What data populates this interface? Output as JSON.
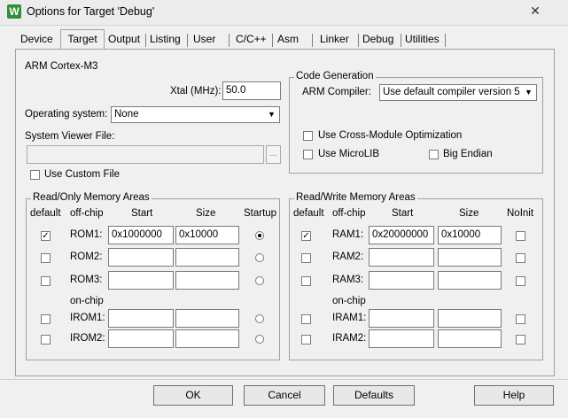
{
  "window": {
    "title": "Options for Target 'Debug'",
    "app_icon": "W",
    "close_glyph": "✕"
  },
  "tabs": [
    "Device",
    "Target",
    "Output",
    "Listing",
    "User",
    "C/C++",
    "Asm",
    "Linker",
    "Debug",
    "Utilities"
  ],
  "active_tab": "Target",
  "target": {
    "device_name": "ARM Cortex-M3",
    "xtal_label": "Xtal (MHz):",
    "xtal_value": "50.0",
    "os_label": "Operating system:",
    "os_value": "None",
    "sysviewer_label": "System Viewer File:",
    "sysviewer_value": "",
    "browse_label": "...",
    "custom_file_label": "Use Custom File"
  },
  "codegen": {
    "title": "Code Generation",
    "compiler_label": "ARM Compiler:",
    "compiler_value": "Use default compiler version 5",
    "cross_module_label": "Use Cross-Module Optimization",
    "microlib_label": "Use MicroLIB",
    "big_endian_label": "Big Endian"
  },
  "ro_memory": {
    "title": "Read/Only Memory Areas",
    "col_default": "default",
    "col_offchip": "off-chip",
    "col_start": "Start",
    "col_size": "Size",
    "col_startup": "Startup",
    "onchip_label": "on-chip",
    "rows": [
      {
        "name": "ROM1:",
        "default": true,
        "start": "0x1000000",
        "size": "0x10000",
        "startup": true
      },
      {
        "name": "ROM2:",
        "default": false,
        "start": "",
        "size": "",
        "startup": false
      },
      {
        "name": "ROM3:",
        "default": false,
        "start": "",
        "size": "",
        "startup": false
      },
      {
        "name": "IROM1:",
        "default": false,
        "start": "",
        "size": "",
        "startup": false
      },
      {
        "name": "IROM2:",
        "default": false,
        "start": "",
        "size": "",
        "startup": false
      }
    ]
  },
  "rw_memory": {
    "title": "Read/Write Memory Areas",
    "col_default": "default",
    "col_offchip": "off-chip",
    "col_start": "Start",
    "col_size": "Size",
    "col_noinit": "NoInit",
    "onchip_label": "on-chip",
    "rows": [
      {
        "name": "RAM1:",
        "default": true,
        "start": "0x20000000",
        "size": "0x10000",
        "noinit": false
      },
      {
        "name": "RAM2:",
        "default": false,
        "start": "",
        "size": "",
        "noinit": false
      },
      {
        "name": "RAM3:",
        "default": false,
        "start": "",
        "size": "",
        "noinit": false
      },
      {
        "name": "IRAM1:",
        "default": false,
        "start": "",
        "size": "",
        "noinit": false
      },
      {
        "name": "IRAM2:",
        "default": false,
        "start": "",
        "size": "",
        "noinit": false
      }
    ]
  },
  "buttons": {
    "ok": "OK",
    "cancel": "Cancel",
    "defaults": "Defaults",
    "help": "Help"
  },
  "glyphs": {
    "check": "✓",
    "dropdown": "▼"
  }
}
